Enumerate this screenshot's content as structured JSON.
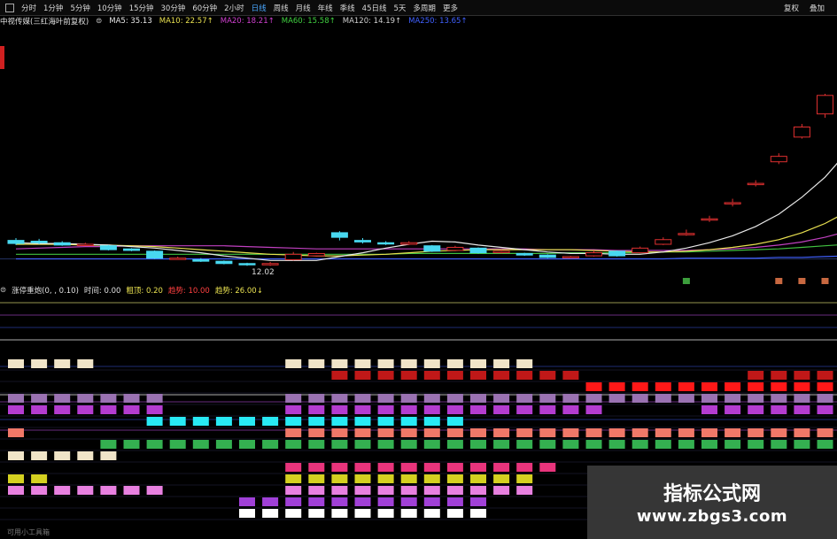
{
  "toolbar": {
    "tabs": [
      {
        "label": "分时",
        "active": false
      },
      {
        "label": "1分钟",
        "active": false
      },
      {
        "label": "5分钟",
        "active": false
      },
      {
        "label": "10分钟",
        "active": false
      },
      {
        "label": "15分钟",
        "active": false
      },
      {
        "label": "30分钟",
        "active": false
      },
      {
        "label": "60分钟",
        "active": false
      },
      {
        "label": "2小时",
        "active": false
      },
      {
        "label": "日线",
        "active": true
      },
      {
        "label": "周线",
        "active": false
      },
      {
        "label": "月线",
        "active": false
      },
      {
        "label": "年线",
        "active": false
      },
      {
        "label": "季线",
        "active": false
      },
      {
        "label": "45日线",
        "active": false
      },
      {
        "label": "5天",
        "active": false
      },
      {
        "label": "多周期",
        "active": false
      },
      {
        "label": "更多",
        "active": false
      }
    ],
    "right": [
      "复权",
      "叠加"
    ]
  },
  "infobar": {
    "stock_name": "中视传媒(三红海叶前复权)",
    "ma_items": [
      {
        "text": "MA5: 35.13",
        "color": "#e8e8e8"
      },
      {
        "text": "MA10: 22.57↑",
        "color": "#e8e050"
      },
      {
        "text": "MA20: 18.21↑",
        "color": "#d040d0"
      },
      {
        "text": "MA60: 15.58↑",
        "color": "#40d040"
      },
      {
        "text": "MA120: 14.19↑",
        "color": "#d0d0d0"
      },
      {
        "text": "MA250: 13.65↑",
        "color": "#4060ff"
      }
    ]
  },
  "price_tip": "12.02",
  "indicator": {
    "name": "涨停重炮(0, , 0.10)",
    "items": [
      {
        "text": "时间: 0.00",
        "color": "#e0e0e0"
      },
      {
        "text": "粗顶: 0.20",
        "color": "#e8e050"
      },
      {
        "text": "趋势: 10.00",
        "color": "#ff4040"
      },
      {
        "text": "趋势: 26.00↓",
        "color": "#e8e050"
      }
    ]
  },
  "bottom_label": "可用小工具箱",
  "watermark": {
    "line1": "指标公式网",
    "line2": "www.zbgs3.com"
  },
  "colors": {
    "up_candle": "#e03030",
    "down_candle": "#48d8f0",
    "ma5": "#e8e8e8",
    "ma10": "#e8e050",
    "ma20": "#c040c0",
    "ma60": "#40c040",
    "ma250": "#4060ff"
  },
  "chart_data": {
    "type": "candlestick",
    "title": "",
    "bars": [
      {
        "o": 11.6,
        "c": 11.2,
        "h": 11.9,
        "l": 11.0
      },
      {
        "o": 11.5,
        "c": 11.3,
        "h": 11.8,
        "l": 11.1
      },
      {
        "o": 11.3,
        "c": 11.0,
        "h": 11.5,
        "l": 10.9
      },
      {
        "o": 11.0,
        "c": 11.1,
        "h": 11.3,
        "l": 10.9
      },
      {
        "o": 10.9,
        "c": 10.4,
        "h": 11.0,
        "l": 10.3
      },
      {
        "o": 10.5,
        "c": 10.3,
        "h": 10.6,
        "l": 10.2
      },
      {
        "o": 10.2,
        "c": 9.3,
        "h": 10.3,
        "l": 9.2
      },
      {
        "o": 9.3,
        "c": 9.3,
        "h": 9.5,
        "l": 9.1
      },
      {
        "o": 9.1,
        "c": 8.9,
        "h": 9.3,
        "l": 8.8
      },
      {
        "o": 8.9,
        "c": 8.6,
        "h": 9.0,
        "l": 8.5
      },
      {
        "o": 8.6,
        "c": 8.5,
        "h": 8.7,
        "l": 8.3
      },
      {
        "o": 8.5,
        "c": 8.6,
        "h": 8.8,
        "l": 8.3
      },
      {
        "o": 9.1,
        "c": 9.8,
        "h": 10.1,
        "l": 9.0
      },
      {
        "o": 9.6,
        "c": 9.9,
        "h": 10.0,
        "l": 9.5
      },
      {
        "o": 12.6,
        "c": 12.0,
        "h": 12.8,
        "l": 11.6
      },
      {
        "o": 11.6,
        "c": 11.4,
        "h": 11.9,
        "l": 11.2
      },
      {
        "o": 11.3,
        "c": 11.2,
        "h": 11.5,
        "l": 11.0
      },
      {
        "o": 11.1,
        "c": 11.3,
        "h": 11.5,
        "l": 11.0
      },
      {
        "o": 10.9,
        "c": 10.2,
        "h": 11.0,
        "l": 10.1
      },
      {
        "o": 10.3,
        "c": 10.7,
        "h": 10.9,
        "l": 10.2
      },
      {
        "o": 10.6,
        "c": 10.0,
        "h": 10.7,
        "l": 9.9
      },
      {
        "o": 10.0,
        "c": 10.2,
        "h": 10.4,
        "l": 9.9
      },
      {
        "o": 9.9,
        "c": 9.7,
        "h": 10.0,
        "l": 9.6
      },
      {
        "o": 9.7,
        "c": 9.4,
        "h": 9.8,
        "l": 9.3
      },
      {
        "o": 9.4,
        "c": 9.5,
        "h": 9.6,
        "l": 9.3
      },
      {
        "o": 9.6,
        "c": 10.0,
        "h": 10.3,
        "l": 9.5
      },
      {
        "o": 10.2,
        "c": 9.6,
        "h": 10.3,
        "l": 9.5
      },
      {
        "o": 10.0,
        "c": 10.6,
        "h": 10.8,
        "l": 9.9
      },
      {
        "o": 11.1,
        "c": 11.7,
        "h": 12.0,
        "l": 11.0
      },
      {
        "o": 12.5,
        "c": 12.5,
        "h": 13.0,
        "l": 12.2
      },
      {
        "o": 14.4,
        "c": 14.4,
        "h": 14.8,
        "l": 14.0
      },
      {
        "o": 16.5,
        "c": 16.5,
        "h": 17.0,
        "l": 16.0
      },
      {
        "o": 19.0,
        "c": 19.0,
        "h": 19.4,
        "l": 18.6
      },
      {
        "o": 21.8,
        "c": 22.5,
        "h": 22.9,
        "l": 21.5
      },
      {
        "o": 25.0,
        "c": 26.3,
        "h": 26.7,
        "l": 24.8
      },
      {
        "o": 28.0,
        "c": 30.4,
        "h": 30.6,
        "l": 27.5
      },
      {
        "o": 30.5,
        "c": 35.0,
        "h": 35.2,
        "l": 30.5
      }
    ],
    "ma5": [
      11.3,
      11.2,
      11.2,
      11.1,
      11.0,
      10.8,
      10.6,
      10.3,
      10.0,
      9.6,
      9.3,
      9.0,
      9.0,
      9.0,
      9.5,
      10.0,
      10.6,
      11.1,
      11.5,
      11.4,
      11.0,
      10.7,
      10.4,
      10.1,
      9.9,
      9.9,
      9.8,
      9.8,
      10.1,
      10.6,
      11.3,
      12.2,
      13.4,
      15.0,
      17.2,
      19.8,
      23.2
    ],
    "ma10": [
      11.1,
      11.1,
      11.1,
      11.0,
      11.0,
      10.9,
      10.8,
      10.6,
      10.4,
      10.2,
      10.0,
      9.8,
      9.7,
      9.6,
      9.6,
      9.7,
      9.8,
      10.0,
      10.2,
      10.3,
      10.4,
      10.4,
      10.4,
      10.4,
      10.4,
      10.3,
      10.2,
      10.1,
      10.1,
      10.2,
      10.4,
      10.7,
      11.1,
      11.7,
      12.6,
      13.8,
      15.4
    ],
    "ma20": [
      10.5,
      10.6,
      10.7,
      10.8,
      10.8,
      10.9,
      10.9,
      10.9,
      10.9,
      10.9,
      10.8,
      10.7,
      10.6,
      10.5,
      10.5,
      10.5,
      10.5,
      10.5,
      10.5,
      10.5,
      10.5,
      10.5,
      10.5,
      10.4,
      10.4,
      10.4,
      10.3,
      10.3,
      10.3,
      10.3,
      10.4,
      10.5,
      10.7,
      11.0,
      11.4,
      12.0,
      12.8
    ],
    "ma60": [
      9.8,
      9.8,
      9.8,
      9.8,
      9.8,
      9.8,
      9.8,
      9.8,
      9.8,
      9.8,
      9.8,
      9.8,
      9.8,
      9.8,
      9.8,
      9.8,
      9.8,
      9.9,
      9.9,
      9.9,
      9.9,
      9.9,
      9.9,
      9.9,
      10.0,
      10.0,
      10.0,
      10.0,
      10.1,
      10.1,
      10.2,
      10.3,
      10.4,
      10.5,
      10.7,
      10.9,
      11.1
    ],
    "ma250": [
      9.2,
      9.2,
      9.2,
      9.2,
      9.2,
      9.2,
      9.2,
      9.2,
      9.2,
      9.2,
      9.2,
      9.2,
      9.2,
      9.2,
      9.2,
      9.2,
      9.2,
      9.2,
      9.2,
      9.2,
      9.2,
      9.2,
      9.2,
      9.2,
      9.2,
      9.2,
      9.2,
      9.2,
      9.2,
      9.3,
      9.3,
      9.3,
      9.3,
      9.4,
      9.4,
      9.5,
      9.6
    ],
    "lower_rows": [
      {
        "color": "#f0e4c8",
        "cells": [
          [
            0,
            3
          ],
          [
            12,
            22
          ]
        ]
      },
      {
        "color": "#c01818",
        "cells": [
          [
            14,
            24
          ],
          [
            32,
            36
          ]
        ]
      },
      {
        "color": "#ff1818",
        "cells": [
          [
            25,
            36
          ]
        ]
      },
      {
        "color": "#9a72b2",
        "cells": [
          [
            0,
            6
          ],
          [
            12,
            36
          ]
        ]
      },
      {
        "color": "#b43cd0",
        "cells": [
          [
            0,
            6
          ],
          [
            12,
            25
          ],
          [
            30,
            36
          ]
        ]
      },
      {
        "color": "#28eaf4",
        "cells": [
          [
            6,
            19
          ]
        ]
      },
      {
        "color": "#f07868",
        "cells": [
          [
            0,
            0
          ],
          [
            12,
            36
          ]
        ]
      },
      {
        "color": "#34b050",
        "cells": [
          [
            4,
            36
          ]
        ]
      },
      {
        "color": "#f0e4c8",
        "cells": [
          [
            0,
            4
          ]
        ]
      },
      {
        "color": "#e8347c",
        "cells": [
          [
            12,
            23
          ]
        ]
      },
      {
        "color": "#d4d020",
        "cells": [
          [
            0,
            1
          ],
          [
            12,
            22
          ]
        ]
      },
      {
        "color": "#e880e0",
        "cells": [
          [
            0,
            6
          ],
          [
            12,
            22
          ]
        ]
      },
      {
        "color": "#a040d8",
        "cells": [
          [
            10,
            20
          ]
        ]
      },
      {
        "color": "#ffffff",
        "cells": [
          [
            10,
            20
          ]
        ]
      }
    ]
  }
}
